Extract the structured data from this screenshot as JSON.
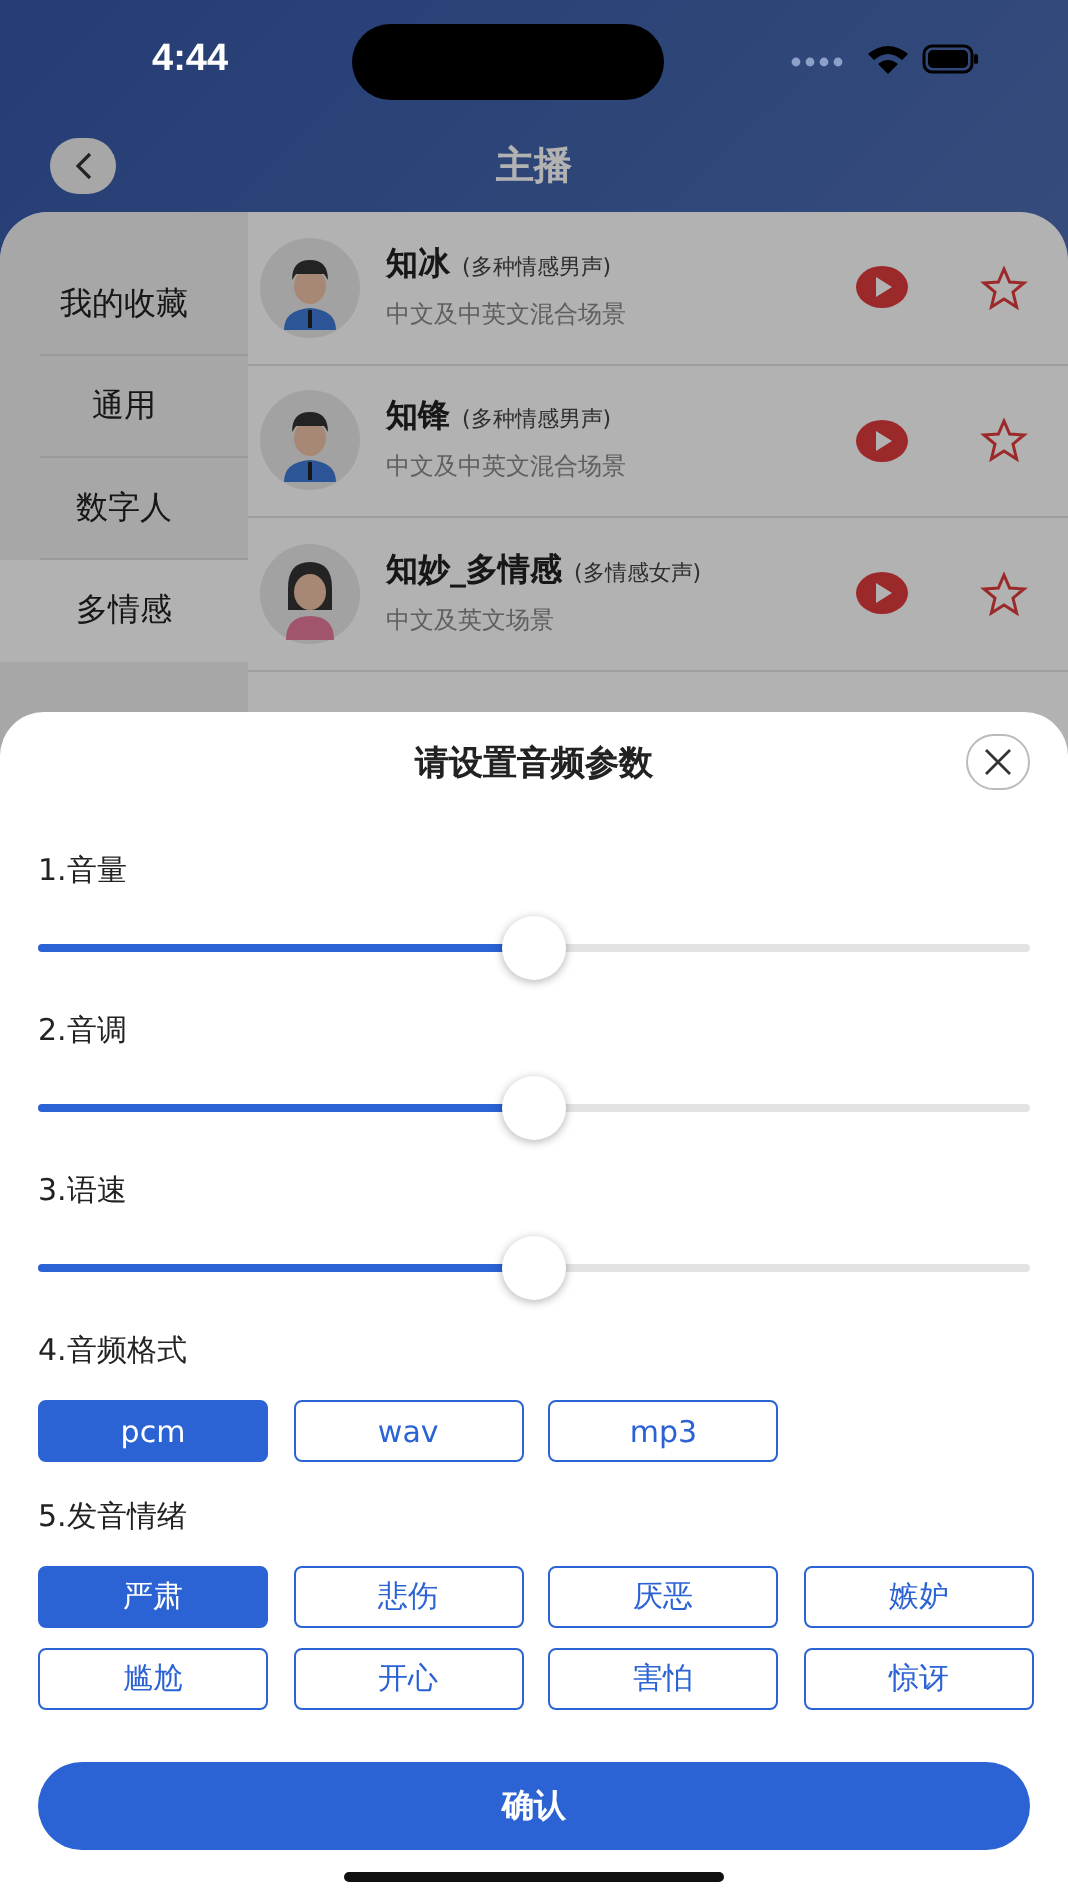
{
  "status_bar": {
    "time": "4:44"
  },
  "header": {
    "title": "主播"
  },
  "sidebar": {
    "items": [
      {
        "label": "我的收藏",
        "selected": false
      },
      {
        "label": "通用",
        "selected": false
      },
      {
        "label": "数字人",
        "selected": false
      },
      {
        "label": "多情感",
        "selected": true
      }
    ]
  },
  "voices": [
    {
      "name": "知冰",
      "tag": "(多种情感男声)",
      "description": "中文及中英文混合场景",
      "kind": "man",
      "favorite": false
    },
    {
      "name": "知锋",
      "tag": "(多种情感男声)",
      "description": "中文及中英文混合场景",
      "kind": "man",
      "favorite": false
    },
    {
      "name": "知妙_多情感",
      "tag": "(多情感女声)",
      "description": "中文及英文场景",
      "kind": "woman",
      "favorite": false
    }
  ],
  "sheet": {
    "title": "请设置音频参数",
    "sliders": [
      {
        "label": "1.音量",
        "level": 0.5
      },
      {
        "label": "2.音调",
        "level": 0.5
      },
      {
        "label": "3.语速",
        "level": 0.5
      }
    ],
    "format": {
      "label": "4.音频格式",
      "options": [
        {
          "label": "pcm",
          "selected": true
        },
        {
          "label": "wav",
          "selected": false
        },
        {
          "label": "mp3",
          "selected": false
        }
      ]
    },
    "emotion": {
      "label": "5.发音情绪",
      "options": [
        {
          "label": "严肃",
          "selected": true
        },
        {
          "label": "悲伤",
          "selected": false
        },
        {
          "label": "厌恶",
          "selected": false
        },
        {
          "label": "嫉妒",
          "selected": false
        },
        {
          "label": "尴尬",
          "selected": false
        },
        {
          "label": "开心",
          "selected": false
        },
        {
          "label": "害怕",
          "selected": false
        },
        {
          "label": "惊讶",
          "selected": false
        }
      ]
    },
    "confirm": "确认"
  }
}
